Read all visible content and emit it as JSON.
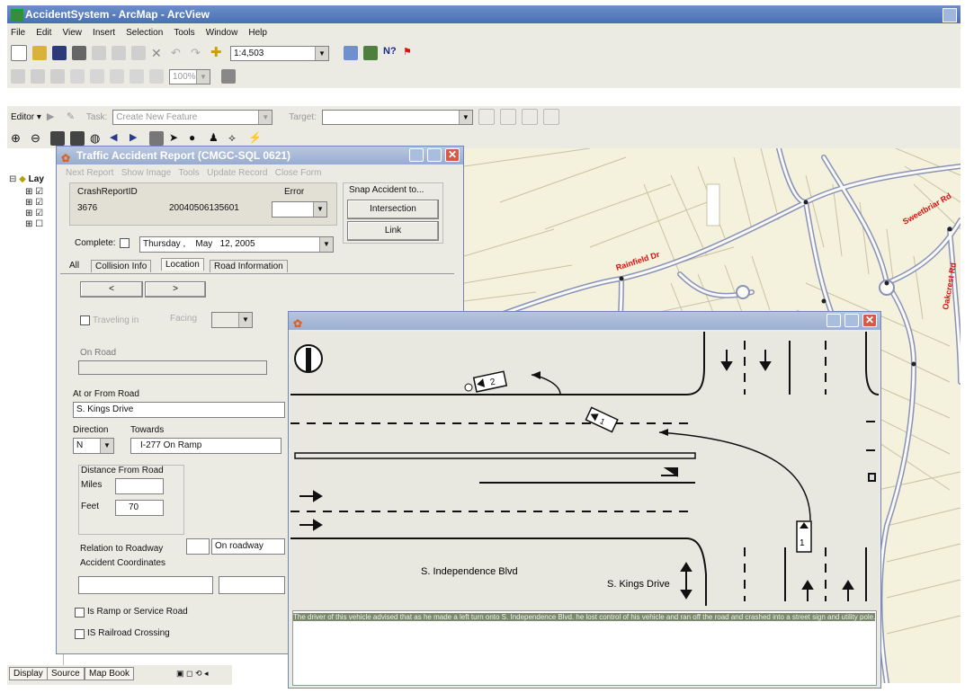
{
  "app": {
    "title": "AccidentSystem - ArcMap - ArcView"
  },
  "menu": [
    "File",
    "Edit",
    "View",
    "Insert",
    "Selection",
    "Tools",
    "Window",
    "Help"
  ],
  "toolbar": {
    "scale": "1:4,503",
    "zoom_combo": "100%"
  },
  "editor": {
    "label": "Editor ▾",
    "task_label": "Task:",
    "task_value": "Create New Feature",
    "target_label": "Target:",
    "target_value": ""
  },
  "toc": {
    "layers_label": "Lay",
    "items": [
      "☑",
      "☑",
      "☑",
      "☐"
    ]
  },
  "bottom_tabs": [
    "Display",
    "Source",
    "Map Book"
  ],
  "map": {
    "streets": [
      "Rainfield Dr",
      "Sweetbriar Rd",
      "Oakcrest Rd"
    ],
    "colors": {
      "background": "#f4f1dc",
      "roads": "#8a92b8",
      "parcel_lines": "#c9c3a3",
      "labels": "#d81010"
    }
  },
  "report_window": {
    "title": "Traffic Accident Report (CMGC-SQL 0621)",
    "menu": [
      "Next Report",
      "Show Image",
      "Tools",
      "Update Record",
      "Close Form"
    ],
    "crash_id_label": "CrashReportID",
    "crash_id": "3676",
    "crash_number": "20040506135601",
    "error_label": "Error",
    "snap_label": "Snap Accident to...",
    "snap_intersection": "Intersection",
    "snap_link": "Link",
    "complete_label": "Complete:",
    "date_day": "Thursday",
    "date_sep": ",",
    "date_month": "May",
    "date_rest": "12, 2005",
    "tabs": [
      "All",
      "Collision Info",
      "Location",
      "Road Information"
    ],
    "nav_prev": "<",
    "nav_next": ">",
    "traveling_label": "Traveling in",
    "facing_label": "Facing",
    "on_road_label": "On Road",
    "at_from_road_label": "At or From Road",
    "at_from_road": "S. Kings Drive",
    "direction_label": "Direction",
    "towards_label": "Towards",
    "direction": "N",
    "towards": "I-277 On Ramp",
    "distance_label": "Distance From Road",
    "miles_label": "Miles",
    "feet_label": "Feet",
    "feet": "70",
    "relation_label": "Relation to Roadway",
    "relation": "On roadway",
    "coords_label": "Accident Coordinates",
    "ramp_label": "Is Ramp or Service Road",
    "railroad_label": "IS Railroad Crossing"
  },
  "diagram_window": {
    "street1": "S. Independence Blvd",
    "street2": "S. Kings Drive",
    "vehicle1": "1",
    "vehicle2": "2",
    "narrative": "The driver of this vehicle advised that as he made a left turn onto S. Independence Blvd. he lost control of his vehicle and ran off the road and crashed into a street sign and utility pole."
  }
}
